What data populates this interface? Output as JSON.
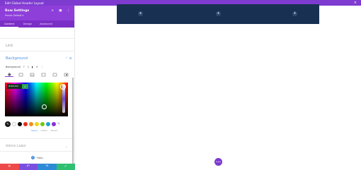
{
  "window": {
    "title": "Edit Global Header Layout",
    "close_icon": "×"
  },
  "panel": {
    "title": "Row Settings",
    "preset": "Preset: Default ▾",
    "header_icons": [
      "×",
      "▣",
      "⋮"
    ],
    "tabs": [
      {
        "label": "Content",
        "active": true
      },
      {
        "label": "Design",
        "active": false
      },
      {
        "label": "Advanced",
        "active": false
      }
    ],
    "sections": {
      "link": "Link",
      "background": "Background",
      "background_label": "Background",
      "background_controls": [
        "?",
        "▯",
        "▮",
        "↺",
        "⋮"
      ],
      "admin_label": "Admin Label"
    },
    "picker": {
      "hex": "#183152",
      "check": "✓",
      "eyedropper": "✎",
      "swatches": [
        {
          "color": "#ffffff"
        },
        {
          "color": "#000000"
        },
        {
          "color": "#e52e1c"
        },
        {
          "color": "#ef8d19"
        },
        {
          "color": "#e9d619"
        },
        {
          "color": "#73c60f"
        },
        {
          "color": "#1fa2d4"
        },
        {
          "color": "#8b2ddc"
        }
      ],
      "pencil": "✎",
      "filters": [
        {
          "label": "Saved",
          "active": true
        },
        {
          "label": "Global",
          "active": false
        },
        {
          "label": "Recent",
          "active": false
        }
      ]
    },
    "help": "Help",
    "footer": [
      {
        "symbol": "✕",
        "color": "#ef4a4a"
      },
      {
        "symbol": "↶",
        "color": "#7a4fe0"
      },
      {
        "symbol": "↷",
        "color": "#2d8bd6"
      },
      {
        "symbol": "✓",
        "color": "#2fbf71"
      }
    ]
  },
  "canvas": {
    "add_buttons": [
      "+",
      "+",
      "+"
    ],
    "menu": "•••"
  }
}
